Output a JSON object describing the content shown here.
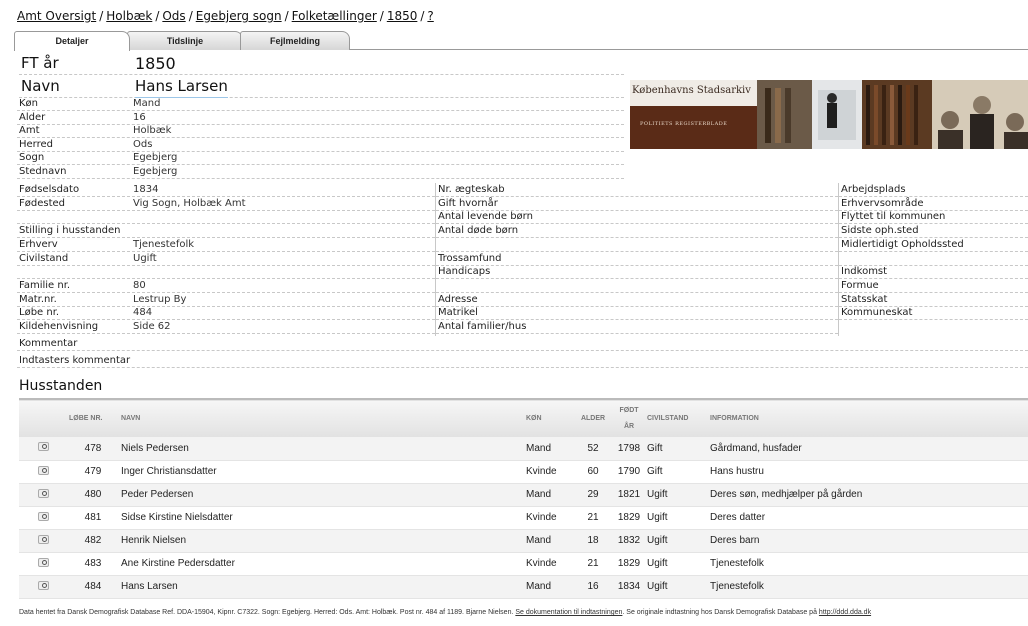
{
  "breadcrumb": [
    "Amt Oversigt",
    "Holbæk",
    "Ods",
    "Egebjerg sogn",
    "Folketællinger",
    "1850",
    "?"
  ],
  "tabs": [
    "Detaljer",
    "Tidslinje",
    "Fejlmelding"
  ],
  "header": {
    "ft_label": "FT år",
    "ft_value": "1850",
    "navn_label": "Navn",
    "navn_value": "Hans Larsen"
  },
  "top_fields": [
    {
      "label": "Køn",
      "value": "Mand"
    },
    {
      "label": "Alder",
      "value": "16"
    },
    {
      "label": "Amt",
      "value": "Holbæk"
    },
    {
      "label": "Herred",
      "value": "Ods"
    },
    {
      "label": "Sogn",
      "value": "Egebjerg"
    },
    {
      "label": "Stednavn",
      "value": "Egebjerg"
    }
  ],
  "banner": {
    "title": "Københavns Stadsarkiv",
    "subtitle": "POLITIETS REGISTERBLADE"
  },
  "col1": [
    {
      "label": "Fødselsdato",
      "value": "1834"
    },
    {
      "label": "Fødested",
      "value": "Vig Sogn, Holbæk Amt"
    },
    {
      "label": "",
      "value": ""
    },
    {
      "label": "Stilling i husstanden",
      "value": ""
    },
    {
      "label": "Erhverv",
      "value": "Tjenestefolk"
    },
    {
      "label": "Civilstand",
      "value": "Ugift"
    },
    {
      "label": "",
      "value": ""
    },
    {
      "label": "Familie nr.",
      "value": "80"
    },
    {
      "label": "Matr.nr.",
      "value": "Lestrup By"
    },
    {
      "label": "Løbe nr.",
      "value": "484"
    },
    {
      "label": "Kildehenvisning",
      "value": "Side 62"
    }
  ],
  "col2": [
    "Nr. ægteskab",
    "Gift hvornår",
    "Antal levende børn",
    "Antal døde børn",
    "",
    "Trossamfund",
    "Handicaps",
    "",
    "Adresse",
    "Matrikel",
    "Antal familier/hus"
  ],
  "col3": [
    "Arbejdsplads",
    "Erhvervsområde",
    "Flyttet til kommunen",
    "Sidste oph.sted",
    "Midlertidigt Opholdssted",
    "",
    "Indkomst",
    "Formue",
    "Statsskat",
    "Kommuneskat"
  ],
  "comments": {
    "kommentar": "Kommentar",
    "indtaster": "Indtasters kommentar"
  },
  "husstanden": {
    "title": "Husstanden",
    "headers": [
      "LØBE NR.",
      "NAVN",
      "KØN",
      "ALDER",
      "FØDT ÅR",
      "CIVILSTAND",
      "INFORMATION"
    ],
    "rows": [
      {
        "nr": "478",
        "navn": "Niels Pedersen",
        "kon": "Mand",
        "alder": "52",
        "fodt": "1798",
        "civil": "Gift",
        "info": "Gårdmand, husfader"
      },
      {
        "nr": "479",
        "navn": "Inger Christiansdatter",
        "kon": "Kvinde",
        "alder": "60",
        "fodt": "1790",
        "civil": "Gift",
        "info": "Hans hustru"
      },
      {
        "nr": "480",
        "navn": "Peder Pedersen",
        "kon": "Mand",
        "alder": "29",
        "fodt": "1821",
        "civil": "Ugift",
        "info": "Deres søn, medhjælper på gården"
      },
      {
        "nr": "481",
        "navn": "Sidse Kirstine Nielsdatter",
        "kon": "Kvinde",
        "alder": "21",
        "fodt": "1829",
        "civil": "Ugift",
        "info": "Deres datter"
      },
      {
        "nr": "482",
        "navn": "Henrik Nielsen",
        "kon": "Mand",
        "alder": "18",
        "fodt": "1832",
        "civil": "Ugift",
        "info": "Deres barn"
      },
      {
        "nr": "483",
        "navn": "Ane Kirstine Pedersdatter",
        "kon": "Kvinde",
        "alder": "21",
        "fodt": "1829",
        "civil": "Ugift",
        "info": "Tjenestefolk"
      },
      {
        "nr": "484",
        "navn": "Hans Larsen",
        "kon": "Mand",
        "alder": "16",
        "fodt": "1834",
        "civil": "Ugift",
        "info": "Tjenestefolk"
      }
    ]
  },
  "footer": {
    "text": "Data hentet fra Dansk Demografisk Database Ref. DDA-15904, Kipnr. C7322. Sogn: Egebjerg. Herred: Ods. Amt: Holbæk. Post nr. 484 af 1189. Bjarne Nielsen.",
    "link1": "Se dokumentation til indtastningen",
    "mid": ". Se originale indtastning hos Dansk Demografisk Database på",
    "link2": "http://ddd.dda.dk"
  }
}
